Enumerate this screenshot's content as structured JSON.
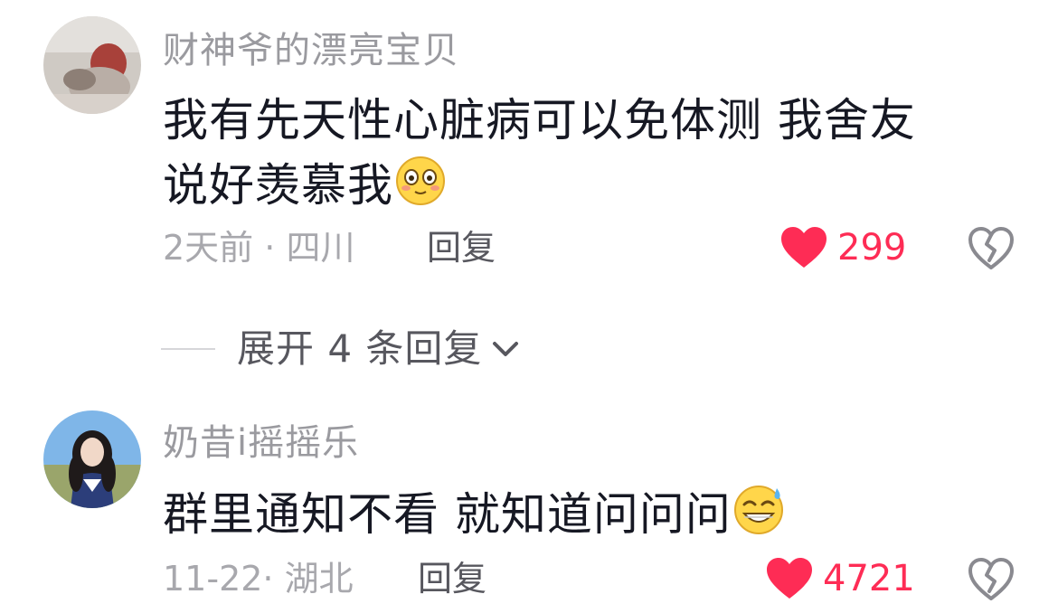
{
  "comments": [
    {
      "username": "财神爷的漂亮宝贝",
      "text_line1": "我有先天性心脏病可以免体测 我舍友",
      "text_line2": "说好羡慕我",
      "emoji_icon": "flushed-face-emoji",
      "time": "2天前",
      "separator": "·",
      "location": "四川",
      "reply_label": "回复",
      "like_count": "299"
    },
    {
      "username": "奶昔i摇摇乐",
      "text_line1": "群里通知不看 就知道问问问",
      "emoji_icon": "grinning-sweat-emoji",
      "time": "11-22",
      "separator": "·",
      "location": "湖北",
      "reply_label": "回复",
      "like_count": "4721"
    }
  ],
  "expand": {
    "label": "展开 4 条回复"
  },
  "colors": {
    "like": "#fe2c55",
    "text": "#161823",
    "secondary": "#9a9a9f"
  }
}
